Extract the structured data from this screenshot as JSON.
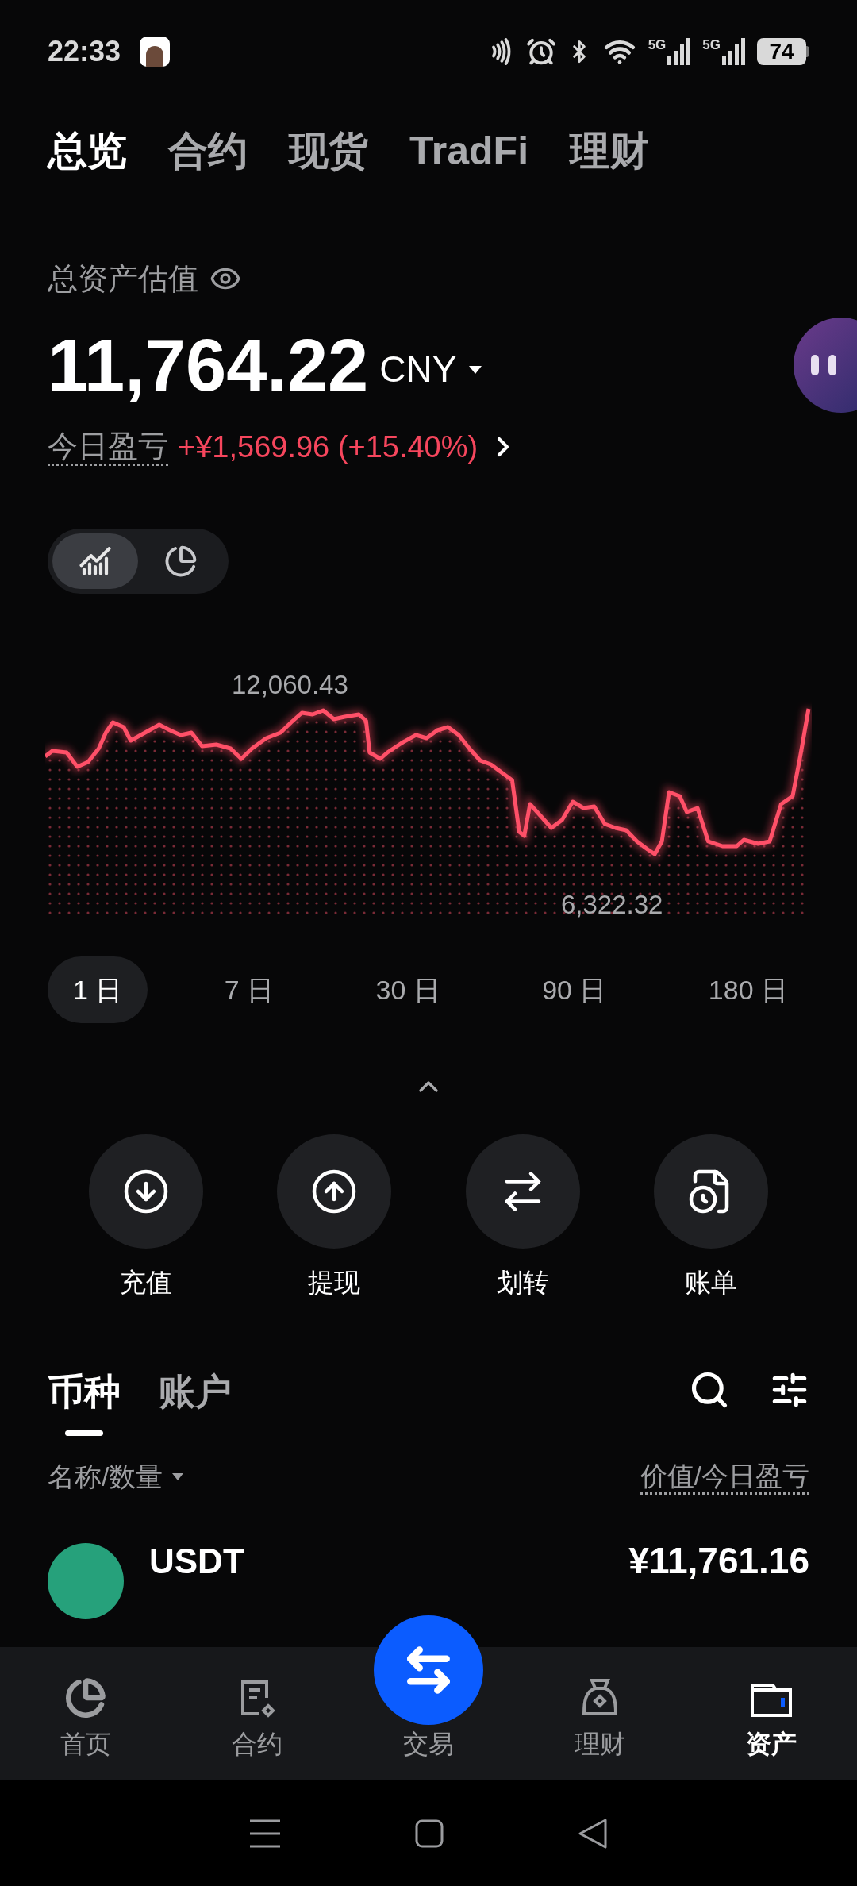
{
  "status_bar": {
    "time": "22:33",
    "network_labels": [
      "5G",
      "5G"
    ],
    "battery": "74"
  },
  "top_tabs": [
    {
      "label": "总览",
      "selected": true
    },
    {
      "label": "合约",
      "selected": false
    },
    {
      "label": "现货",
      "selected": false
    },
    {
      "label": "TradFi",
      "selected": false
    },
    {
      "label": "理财",
      "selected": false
    }
  ],
  "summary": {
    "label": "总资产估值",
    "total": "11,764.22",
    "currency": "CNY",
    "pnl_label": "今日盈亏",
    "pnl_value": "+¥1,569.96 (+15.40%)"
  },
  "view_toggle": [
    {
      "kind": "line",
      "selected": true
    },
    {
      "kind": "pie",
      "selected": false
    }
  ],
  "chart": {
    "high_label": "12,060.43",
    "low_label": "6,322.32"
  },
  "periods": [
    {
      "label": "1 日",
      "selected": true
    },
    {
      "label": "7 日",
      "selected": false
    },
    {
      "label": "30 日",
      "selected": false
    },
    {
      "label": "90 日",
      "selected": false
    },
    {
      "label": "180 日",
      "selected": false
    }
  ],
  "actions": [
    {
      "kind": "deposit",
      "label": "充值"
    },
    {
      "kind": "withdraw",
      "label": "提现"
    },
    {
      "kind": "transfer",
      "label": "划转"
    },
    {
      "kind": "bill",
      "label": "账单"
    }
  ],
  "asset_tabs": [
    {
      "label": "币种",
      "selected": true
    },
    {
      "label": "账户",
      "selected": false
    }
  ],
  "list_header": {
    "left": "名称/数量",
    "right": "价值/今日盈亏"
  },
  "assets": [
    {
      "symbol": "USDT",
      "value": "¥11,761.16"
    }
  ],
  "bottom_nav": [
    {
      "kind": "home",
      "label": "首页",
      "selected": false
    },
    {
      "kind": "contract",
      "label": "合约",
      "selected": false
    },
    {
      "kind": "trade",
      "label": "交易",
      "selected": false
    },
    {
      "kind": "earn",
      "label": "理财",
      "selected": false
    },
    {
      "kind": "assets",
      "label": "资产",
      "selected": true
    }
  ]
}
